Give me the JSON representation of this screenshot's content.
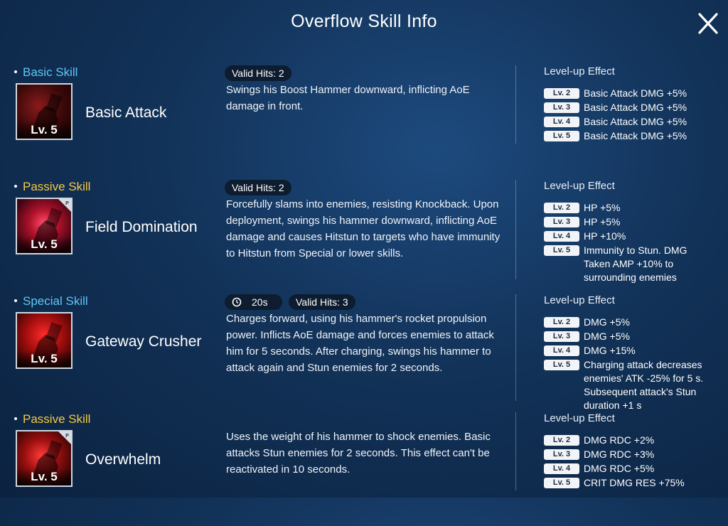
{
  "header": {
    "title": "Overflow Skill Info"
  },
  "sections": [
    {
      "category": "Basic Skill",
      "category_color": "#5ec8f5",
      "name": "Basic Attack",
      "level": "Lv. 5",
      "passive_badge": false,
      "cooldown": "",
      "valid_hits": "Valid Hits: 2",
      "description": "Swings his Boost Hammer downward, inflicting AoE damage in front.",
      "levelup_title": "Level-up Effect",
      "levels": [
        {
          "tag": "Lv. 2",
          "text": "Basic Attack DMG +5%"
        },
        {
          "tag": "Lv. 3",
          "text": "Basic Attack DMG +5%"
        },
        {
          "tag": "Lv. 4",
          "text": "Basic Attack DMG +5%"
        },
        {
          "tag": "Lv. 5",
          "text": "Basic Attack DMG +5%"
        }
      ]
    },
    {
      "category": "Passive Skill",
      "category_color": "#f5c842",
      "name": "Field Domination",
      "level": "Lv. 5",
      "passive_badge": true,
      "badge_letter": "P",
      "cooldown": "",
      "valid_hits": "Valid Hits: 2",
      "description": "Forcefully slams into enemies, resisting Knockback. Upon deployment, swings his hammer downward, inflicting AoE damage and causes Hitstun to targets who have immunity to Hitstun from Special or lower skills.",
      "levelup_title": "Level-up Effect",
      "levels": [
        {
          "tag": "Lv. 2",
          "text": "HP +5%"
        },
        {
          "tag": "Lv. 3",
          "text": "HP +5%"
        },
        {
          "tag": "Lv. 4",
          "text": "HP +10%"
        },
        {
          "tag": "Lv. 5",
          "text": "Immunity to Stun. DMG Taken AMP +10% to surrounding enemies"
        }
      ]
    },
    {
      "category": "Special Skill",
      "category_color": "#5ec8f5",
      "name": "Gateway Crusher",
      "level": "Lv. 5",
      "passive_badge": false,
      "cooldown": "20s",
      "valid_hits": "Valid Hits: 3",
      "description": "Charges forward, using his hammer's rocket propulsion power. Inflicts AoE damage and forces enemies to attack him for 5 seconds. After charging, swings his hammer to attack again and Stun enemies for 2 seconds.",
      "levelup_title": "Level-up Effect",
      "levels": [
        {
          "tag": "Lv. 2",
          "text": "DMG +5%"
        },
        {
          "tag": "Lv. 3",
          "text": "DMG +5%"
        },
        {
          "tag": "Lv. 4",
          "text": "DMG +15%"
        },
        {
          "tag": "Lv. 5",
          "text": "Charging attack decreases enemies' ATK -25% for 5 s. Subsequent attack's Stun duration +1 s"
        }
      ]
    },
    {
      "category": "Passive Skill",
      "category_color": "#f5c842",
      "name": "Overwhelm",
      "level": "Lv. 5",
      "passive_badge": true,
      "badge_letter": "P",
      "cooldown": "",
      "valid_hits": "",
      "description": "Uses the weight of his hammer to shock enemies. Basic attacks Stun enemies for 2 seconds. This effect can't be reactivated in 10 seconds.",
      "levelup_title": "Level-up Effect",
      "levels": [
        {
          "tag": "Lv. 2",
          "text": "DMG RDC +2%"
        },
        {
          "tag": "Lv. 3",
          "text": "DMG RDC +3%"
        },
        {
          "tag": "Lv. 4",
          "text": "DMG RDC +5%"
        },
        {
          "tag": "Lv. 5",
          "text": "CRIT DMG RES +75%"
        }
      ]
    }
  ]
}
